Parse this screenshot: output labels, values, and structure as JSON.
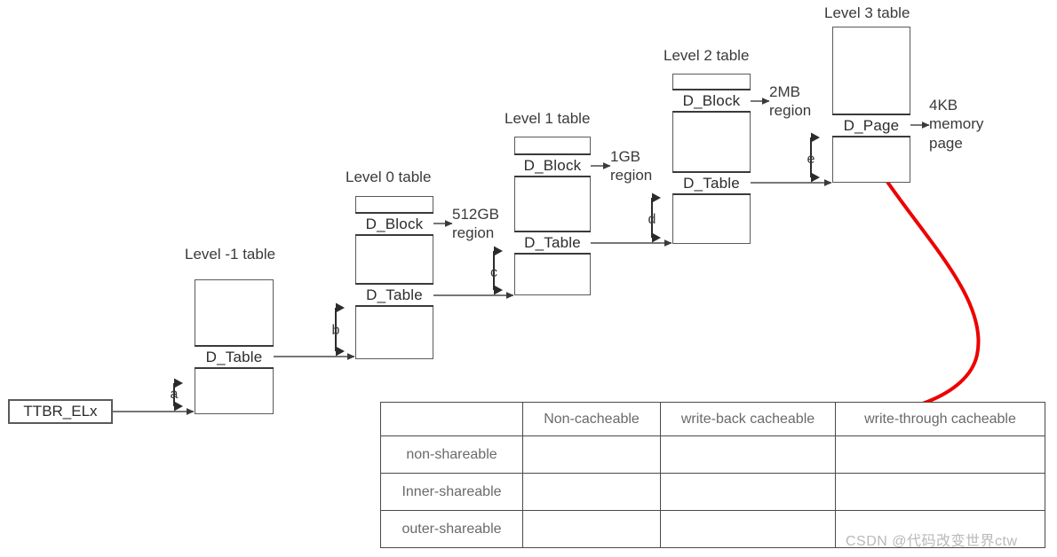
{
  "diagram": {
    "title_hint": "ARMv8 translation table walk",
    "root_register": {
      "label": "TTBR_ELx"
    },
    "tables": [
      {
        "id": "level-minus-1",
        "caption": "Level -1 table",
        "entries": [
          {
            "label": "D_Table"
          }
        ],
        "gap_label": "a",
        "out_gap_label": "b"
      },
      {
        "id": "level-0",
        "caption": "Level 0 table",
        "entries": [
          {
            "label": "D_Block"
          },
          {
            "label": "D_Table"
          }
        ],
        "region_label": "512GB\nregion",
        "region_line1": "512GB",
        "region_line2": "region",
        "out_gap_label": "c"
      },
      {
        "id": "level-1",
        "caption": "Level 1 table",
        "entries": [
          {
            "label": "D_Block"
          },
          {
            "label": "D_Table"
          }
        ],
        "region_line1": "1GB",
        "region_line2": "region",
        "out_gap_label": "d"
      },
      {
        "id": "level-2",
        "caption": "Level 2 table",
        "entries": [
          {
            "label": "D_Block"
          },
          {
            "label": "D_Table"
          }
        ],
        "region_line1": "2MB",
        "region_line2": "region",
        "out_gap_label": "e"
      },
      {
        "id": "level-3",
        "caption": "Level 3 table",
        "entries": [
          {
            "label": "D_Page"
          }
        ],
        "region_line1": "4KB",
        "region_line2": "memory",
        "region_line3": "page"
      }
    ],
    "colors": {
      "box_stroke": "#5a5a5a",
      "entry_stroke": "#3a3a3a",
      "text": "#3a3a3a",
      "connector": "#4a4a4a",
      "annotation_arrow": "#ee0000",
      "watermark": "#b9b9b9"
    }
  },
  "matrix": {
    "corner_label": "",
    "columns": [
      "Non-cacheable",
      "write-back cacheable",
      "write-through cacheable"
    ],
    "rows": [
      {
        "label": "non-shareable",
        "cells": [
          "",
          "",
          ""
        ]
      },
      {
        "label": "Inner-shareable",
        "cells": [
          "",
          "",
          ""
        ]
      },
      {
        "label": "outer-shareable",
        "cells": [
          "",
          "",
          ""
        ]
      }
    ]
  },
  "watermark": {
    "text": "CSDN @代码改变世界ctw"
  }
}
